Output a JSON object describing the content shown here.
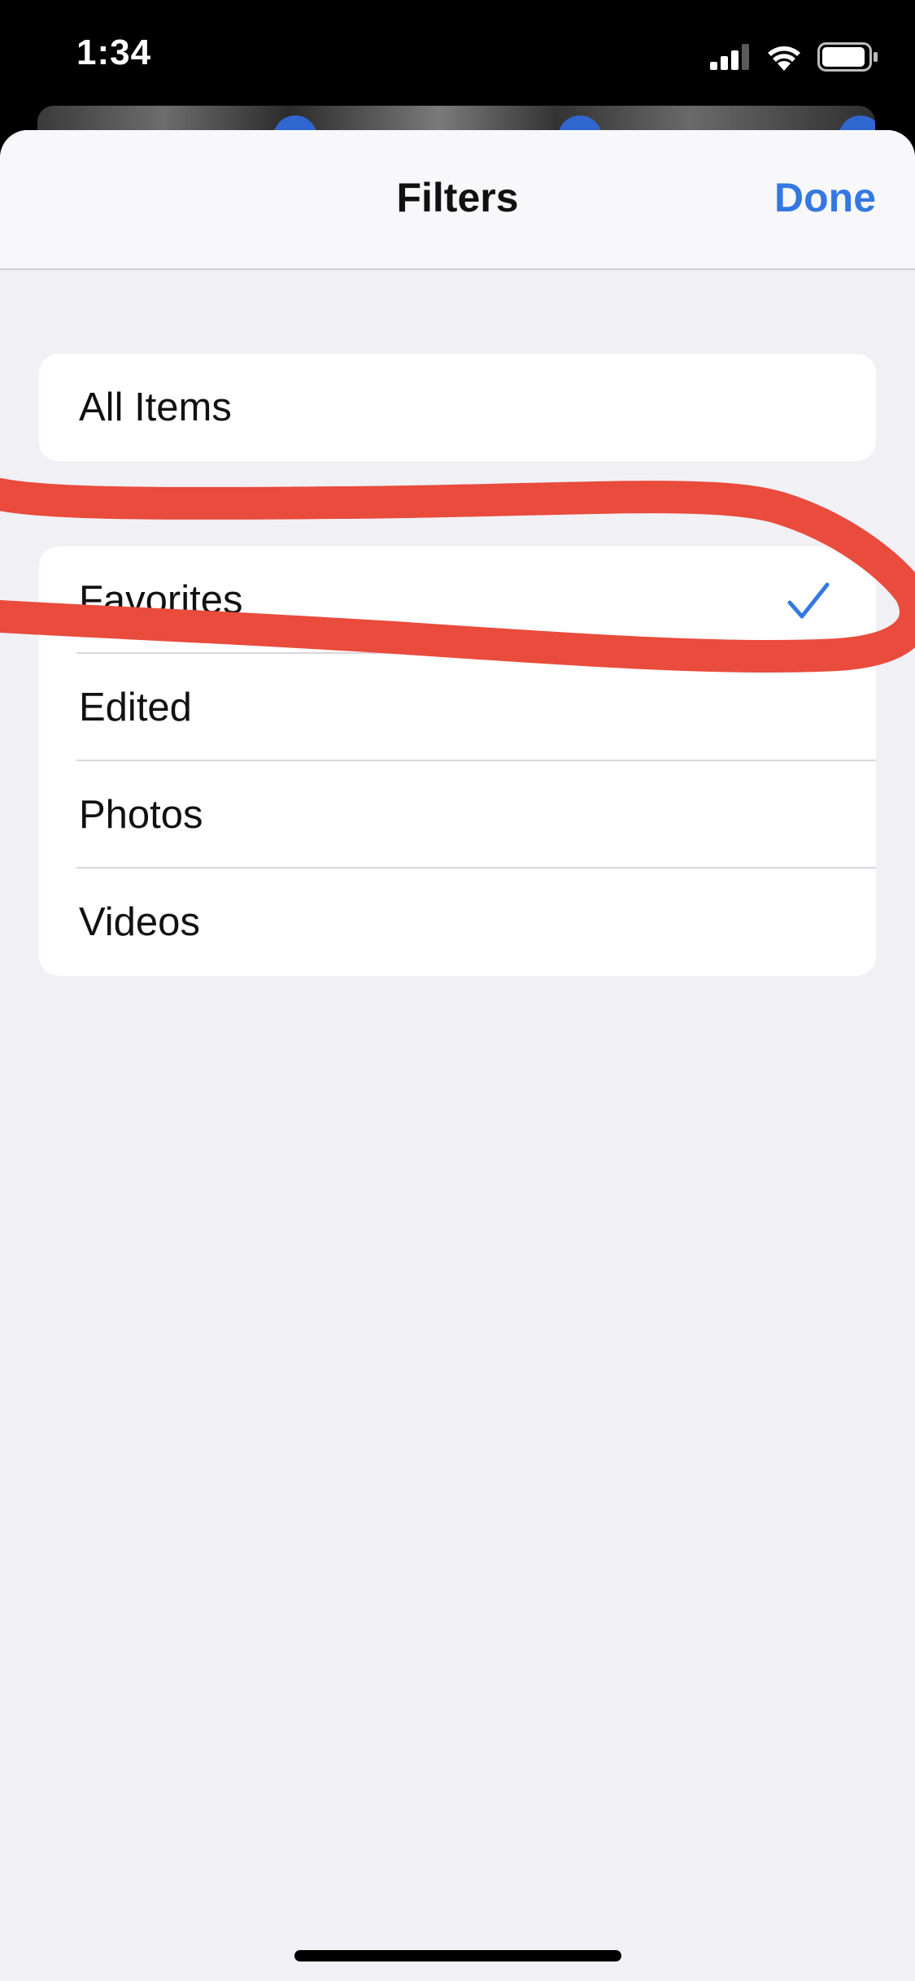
{
  "status_bar": {
    "time": "1:34",
    "icons": [
      "cellular-signal-icon",
      "wifi-icon",
      "battery-icon"
    ]
  },
  "sheet": {
    "title": "Filters",
    "done_label": "Done"
  },
  "filters": {
    "group1": [
      {
        "label": "All Items",
        "selected": false
      }
    ],
    "group2": [
      {
        "label": "Favorites",
        "selected": true
      },
      {
        "label": "Edited",
        "selected": false
      },
      {
        "label": "Photos",
        "selected": false
      },
      {
        "label": "Videos",
        "selected": false
      }
    ]
  },
  "colors": {
    "accent": "#3478e0",
    "annotation": "#e94b3c",
    "background": "#f0f0f5"
  }
}
